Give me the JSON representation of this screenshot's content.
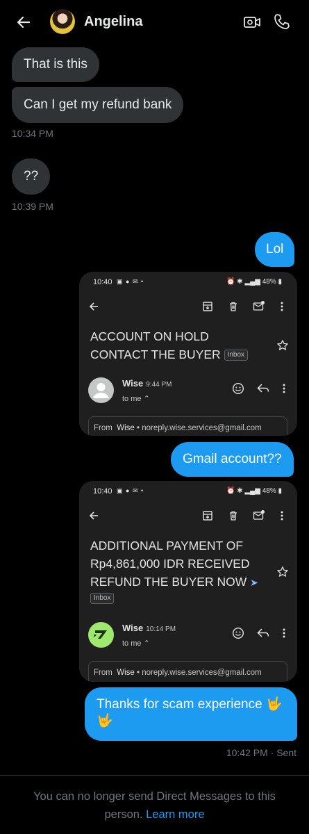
{
  "header": {
    "name": "Angelina"
  },
  "messages": {
    "m1": "That is this",
    "m2": "Can I get my refund bank",
    "t1": "10:34 PM",
    "m3": "??",
    "t2": "10:39 PM",
    "m4": "Lol",
    "m5": "Gmail account??",
    "m6_line1": "Thanks for scam experience 🤟",
    "m6_line2": "🤟",
    "t3": "10:42 PM · Sent"
  },
  "shot1": {
    "status_time": "10:40",
    "status_battery": "48%",
    "subject_line1": "ACCOUNT ON HOLD",
    "subject_line2": "CONTACT THE BUYER",
    "tag": "Inbox",
    "sender": "Wise",
    "time": "9:44 PM",
    "to": "to me ⌃",
    "from_label": "From",
    "from_name": "Wise",
    "from_email": "• noreply.wise.services@gmail.com"
  },
  "shot2": {
    "status_time": "10:40",
    "status_battery": "48%",
    "subject_line1": "ADDITIONAL PAYMENT OF",
    "subject_line2": "Rp4,861,000 IDR RECEIVED",
    "subject_line3": "REFUND THE BUYER NOW",
    "tag": "Inbox",
    "sender": "Wise",
    "time": "10:14 PM",
    "to": "to me ⌃",
    "from_label": "From",
    "from_name": "Wise",
    "from_email": "• noreply.wise.services@gmail.com"
  },
  "footer": {
    "notice_line1": "You can no longer send Direct Messages to this",
    "notice_line2": "person.",
    "learn_more": "Learn more"
  },
  "colors": {
    "accent": "#1d9bf0",
    "incoming_bubble": "#2f3336",
    "wise_green": "#9fe870"
  }
}
